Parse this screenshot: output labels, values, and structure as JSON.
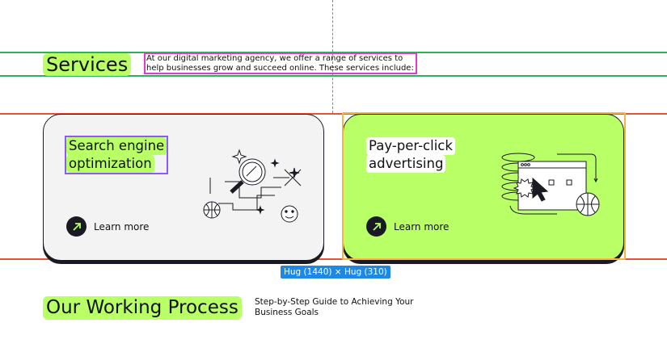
{
  "services": {
    "title": "Services",
    "intro": "At our digital marketing agency, we offer a range of services to help businesses grow and succeed online. These services include:"
  },
  "cards": [
    {
      "title_line1": "Search engine",
      "title_line2": "optimization",
      "cta": "Learn more"
    },
    {
      "title_line1": "Pay-per-click",
      "title_line2": "advertising",
      "cta": "Learn more"
    }
  ],
  "dimension_badge": "Hug (1440) × Hug (310)",
  "process": {
    "title": "Our Working Process",
    "subtitle": "Step-by-Step Guide to Achieving Your Business Goals"
  },
  "colors": {
    "accent_green": "#b9ff66",
    "card_gray": "#f3f3f3",
    "dark": "#191a23",
    "guide_green": "#2fae5b",
    "guide_red": "#e5533d",
    "selection_blue": "#1e88e5"
  },
  "icons": [
    "arrow-up-right-icon",
    "magnifier-illustration-icon",
    "globe-icon",
    "smiley-icon",
    "sparkle-icon",
    "browser-window-icon",
    "cursor-click-icon"
  ]
}
